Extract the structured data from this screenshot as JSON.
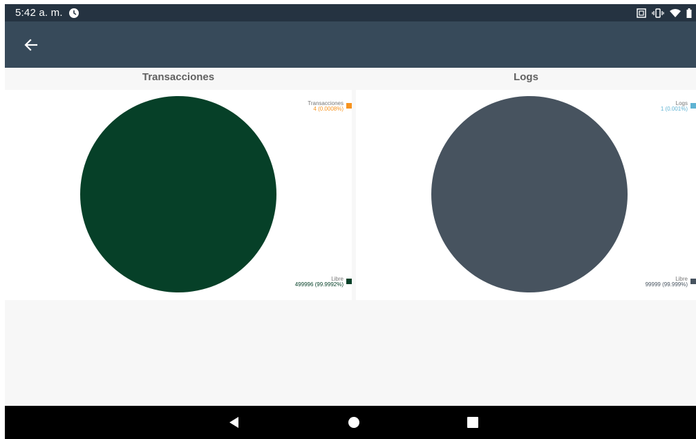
{
  "status": {
    "time": "5:42 a. m."
  },
  "app_bar": {
    "back_icon": "arrow-back-icon"
  },
  "charts": [
    {
      "title": "Transacciones",
      "pie_color": "#064028",
      "legend": [
        {
          "name": "Transacciones",
          "value": "4 (0.0008%)",
          "color": "#f7931e"
        },
        {
          "name": "Libre",
          "value": "499996 (99.9992%)",
          "color": "#064028"
        }
      ]
    },
    {
      "title": "Logs",
      "pie_color": "#47535f",
      "legend": [
        {
          "name": "Logs",
          "value": "1 (0.001%)",
          "color": "#5fb3d3"
        },
        {
          "name": "Libre",
          "value": "99999 (99.999%)",
          "color": "#47535f"
        }
      ]
    }
  ],
  "chart_data": [
    {
      "type": "pie",
      "title": "Transacciones",
      "labels": [
        "Transacciones",
        "Libre"
      ],
      "values": [
        4,
        499996
      ],
      "percentages": [
        0.0008,
        99.9992
      ],
      "colors": [
        "#f7931e",
        "#064028"
      ],
      "legend": "right"
    },
    {
      "type": "pie",
      "title": "Logs",
      "labels": [
        "Logs",
        "Libre"
      ],
      "values": [
        1,
        99999
      ],
      "percentages": [
        0.001,
        99.999
      ],
      "colors": [
        "#5fb3d3",
        "#47535f"
      ],
      "legend": "right"
    }
  ],
  "nav": {
    "back": "nav-back-icon",
    "home": "nav-home-icon",
    "recents": "nav-recents-icon"
  }
}
